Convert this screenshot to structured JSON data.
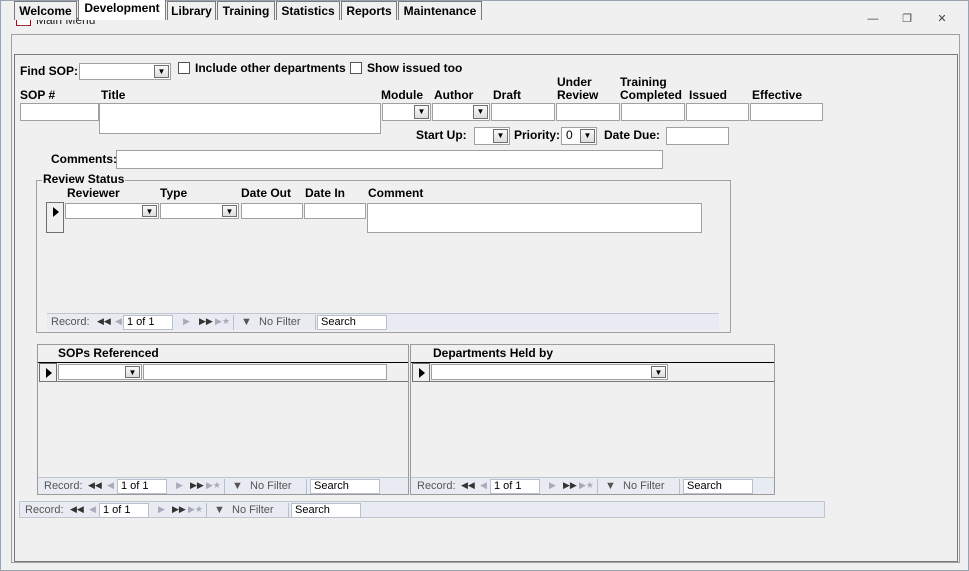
{
  "window": {
    "title": "Main Menu"
  },
  "tabs": [
    "Welcome",
    "Development",
    "Library",
    "Training",
    "Statistics",
    "Reports",
    "Maintenance"
  ],
  "find": {
    "label": "Find SOP:",
    "include_other_label": "Include other departments",
    "show_issued_label": "Show issued too"
  },
  "fields": {
    "sop_no": "SOP #",
    "title": "Title",
    "module": "Module",
    "author": "Author",
    "draft": "Draft",
    "under_review_1": "Under",
    "under_review_2": "Review",
    "training_completed_1": "Training",
    "training_completed_2": "Completed",
    "issued": "Issued",
    "effective": "Effective",
    "start_up": "Start Up:",
    "priority": "Priority:",
    "priority_value": "0",
    "date_due": "Date Due:",
    "comments": "Comments:"
  },
  "review": {
    "title": "Review Status",
    "col_reviewer": "Reviewer",
    "col_type": "Type",
    "col_date_out": "Date Out",
    "col_date_in": "Date In",
    "col_comment": "Comment"
  },
  "referenced": {
    "title": "SOPs Referenced"
  },
  "departments": {
    "title": "Departments Held by"
  },
  "nav": {
    "record": "Record:",
    "position": "1 of 1",
    "no_filter": "No Filter",
    "search": "Search"
  }
}
